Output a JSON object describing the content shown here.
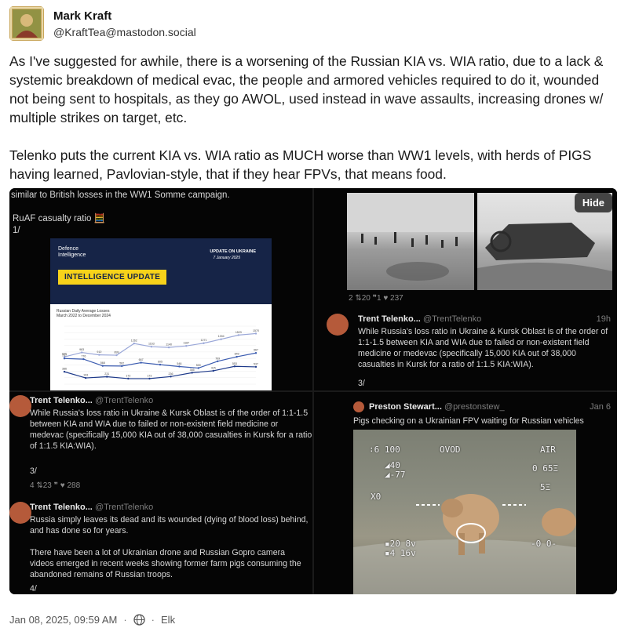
{
  "post": {
    "author_name": "Mark Kraft",
    "author_handle": "@KraftTea@mastodon.social",
    "paragraphs": [
      "As I've suggested for awhile, there is a worsening of the Russian KIA vs. WIA ratio, due to a lack & systemic breakdown of medical evac, the people and armored vehicles required to do it, wounded not being sent to hospitals, as they go AWOL, used instead in wave assaults, increasing drones w/ multiple strikes on target, etc.",
      "Telenko puts the current KIA vs. WIA ratio as MUCH worse than WW1 levels, with herds of PIGS having learned, Pavlovian-style, that if they hear FPVs, that means food."
    ],
    "timestamp": "Jan 08, 2025, 09:59 AM",
    "sep1": "·",
    "sep2": "·",
    "client": "Elk"
  },
  "media": {
    "hide_label": "Hide",
    "cell1": {
      "top_line": "similar to British losses in the WW1 Somme campaign.",
      "ratio_line": "RuAF casualty ratio",
      "ratio_emoji": "🧮",
      "index": "1/",
      "brand_line1": "Defence",
      "brand_line2": "Intelligence",
      "update_label": "UPDATE ON UKRAINE",
      "update_date": "7 January 2025",
      "band": "INTELLIGENCE UPDATE",
      "chart_title_1": "Russian Daily Average Losses",
      "chart_title_2": "March 2022 to December 2024"
    },
    "cell2": {
      "stats": "2  ⇅20  ❞1  ♥ 237",
      "name": "Trent Telenko...",
      "handle": "@TrentTelenko",
      "time": "19h",
      "text": "While Russia's loss ratio in Ukraine & Kursk Oblast is of the order of 1:1-1.5 between KIA and WIA due to failed or non-existent field medicine or medevac (specifically 15,000 KIA out of 38,000 casualties in Kursk for a ratio of 1:1.5 KIA:WIA).",
      "index": "3/"
    },
    "cell3": {
      "name": "Trent Telenko...",
      "handle": "@TrentTelenko",
      "text": "While Russia's loss ratio in Ukraine & Kursk Oblast is of the order of 1:1-1.5 between KIA and WIA due to failed or non-existent field medicine or medevac (specifically 15,000 KIA out of 38,000 casualties in Kursk for a ratio of 1:1.5 KIA:WIA).",
      "index": "3/",
      "stats": "4  ⇅23  ❞  ♥ 288",
      "name2": "Trent Telenko...",
      "handle2": "@TrentTelenko",
      "text2a": "Russia simply leaves its dead and its wounded (dying of blood loss) behind, and has done so for years.",
      "text2b": "There have been a lot of Ukrainian drone and Russian Gopro camera videos emerged in recent weeks showing former farm pigs consuming the abandoned remains of Russian troops.",
      "index2": "4/"
    },
    "cell4": {
      "name": "Preston Stewart...",
      "handle": "@prestonstew_",
      "time": "Jan 6",
      "text": "Pigs checking on a Ukrainian FPV waiting for Russian vehicles",
      "hud_tl": "∶6 100",
      "hud_tc": "OVOD",
      "hud_tr": "AIR",
      "hud_l1": "◢40",
      "hud_l2": "◢-77",
      "hud_r1": "0 65Ξ",
      "hud_r2": "5Ξ",
      "hud_x": "X0",
      "hud_b1": "▪20 8v",
      "hud_b2": "▪4 16v",
      "hud_br": "-0 0-"
    }
  },
  "chart_data": {
    "type": "line",
    "title": "Russian Daily Average Losses",
    "subtitle": "March 2022 to December 2024",
    "ylim": [
      0,
      1800
    ],
    "series": [
      {
        "values": [
          846,
          983,
          910,
          899,
          1262,
          1163,
          1140,
          1187,
          1271,
          1394,
          1523,
          1570
        ]
      },
      {
        "values": [
          797,
          776,
          568,
          562,
          667,
          605,
          548,
          500,
          709,
          849,
          967
        ]
      },
      {
        "values": [
          386,
          193,
          231,
          172,
          173,
          236,
          355,
          415,
          553,
          537
        ]
      }
    ]
  }
}
